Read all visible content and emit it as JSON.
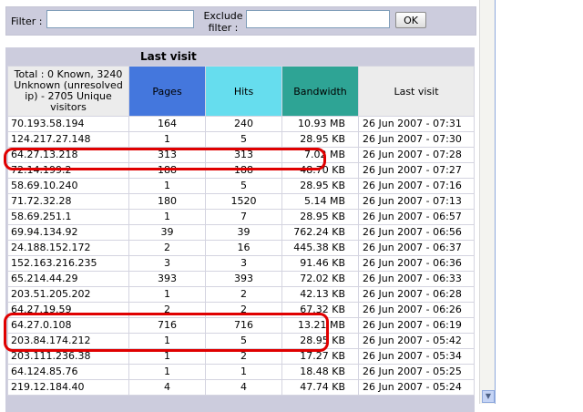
{
  "filter": {
    "filter_label": "Filter :",
    "exclude_label": "Exclude filter :",
    "ok_label": "OK",
    "filter_value": "",
    "exclude_value": ""
  },
  "panel": {
    "title": "Last visit",
    "headers": {
      "host": "Total : 0 Known, 3240 Unknown (unresolved ip) - 2705 Unique visitors",
      "pages": "Pages",
      "hits": "Hits",
      "bandwidth": "Bandwidth",
      "last_visit": "Last visit"
    },
    "header_colors": {
      "pages": "#4477dd",
      "hits": "#66ddee",
      "bandwidth": "#2ea495"
    },
    "highlight_color": "#e00000",
    "rows": [
      {
        "host": "70.193.58.194",
        "pages": "164",
        "hits": "240",
        "bandwidth": "10.93 MB",
        "last": "26 Jun 2007 - 07:31"
      },
      {
        "host": "124.217.27.148",
        "pages": "1",
        "hits": "5",
        "bandwidth": "28.95 KB",
        "last": "26 Jun 2007 - 07:30"
      },
      {
        "host": "64.27.13.218",
        "pages": "313",
        "hits": "313",
        "bandwidth": "7.02 MB",
        "last": "26 Jun 2007 - 07:28"
      },
      {
        "host": "72.14.199.2",
        "pages": "188",
        "hits": "188",
        "bandwidth": "48.70 KB",
        "last": "26 Jun 2007 - 07:27"
      },
      {
        "host": "58.69.10.240",
        "pages": "1",
        "hits": "5",
        "bandwidth": "28.95 KB",
        "last": "26 Jun 2007 - 07:16"
      },
      {
        "host": "71.72.32.28",
        "pages": "180",
        "hits": "1520",
        "bandwidth": "5.14 MB",
        "last": "26 Jun 2007 - 07:13"
      },
      {
        "host": "58.69.251.1",
        "pages": "1",
        "hits": "7",
        "bandwidth": "28.95 KB",
        "last": "26 Jun 2007 - 06:57"
      },
      {
        "host": "69.94.134.92",
        "pages": "39",
        "hits": "39",
        "bandwidth": "762.24 KB",
        "last": "26 Jun 2007 - 06:56"
      },
      {
        "host": "24.188.152.172",
        "pages": "2",
        "hits": "16",
        "bandwidth": "445.38 KB",
        "last": "26 Jun 2007 - 06:37"
      },
      {
        "host": "152.163.216.235",
        "pages": "3",
        "hits": "3",
        "bandwidth": "91.46 KB",
        "last": "26 Jun 2007 - 06:36"
      },
      {
        "host": "65.214.44.29",
        "pages": "393",
        "hits": "393",
        "bandwidth": "72.02 KB",
        "last": "26 Jun 2007 - 06:33"
      },
      {
        "host": "203.51.205.202",
        "pages": "1",
        "hits": "2",
        "bandwidth": "42.13 KB",
        "last": "26 Jun 2007 - 06:28"
      },
      {
        "host": "64.27.19.59",
        "pages": "2",
        "hits": "2",
        "bandwidth": "67.32 KB",
        "last": "26 Jun 2007 - 06:26"
      },
      {
        "host": "64.27.0.108",
        "pages": "716",
        "hits": "716",
        "bandwidth": "13.21 MB",
        "last": "26 Jun 2007 - 06:19"
      },
      {
        "host": "203.84.174.212",
        "pages": "1",
        "hits": "5",
        "bandwidth": "28.95 KB",
        "last": "26 Jun 2007 - 05:42"
      },
      {
        "host": "203.111.236.38",
        "pages": "1",
        "hits": "2",
        "bandwidth": "17.27 KB",
        "last": "26 Jun 2007 - 05:34"
      },
      {
        "host": "64.124.85.76",
        "pages": "1",
        "hits": "1",
        "bandwidth": "18.48 KB",
        "last": "26 Jun 2007 - 05:25"
      },
      {
        "host": "219.12.184.40",
        "pages": "4",
        "hits": "4",
        "bandwidth": "47.74 KB",
        "last": "26 Jun 2007 - 05:24"
      }
    ]
  },
  "scrollbar": {
    "down_icon": "arrow-down-icon"
  }
}
